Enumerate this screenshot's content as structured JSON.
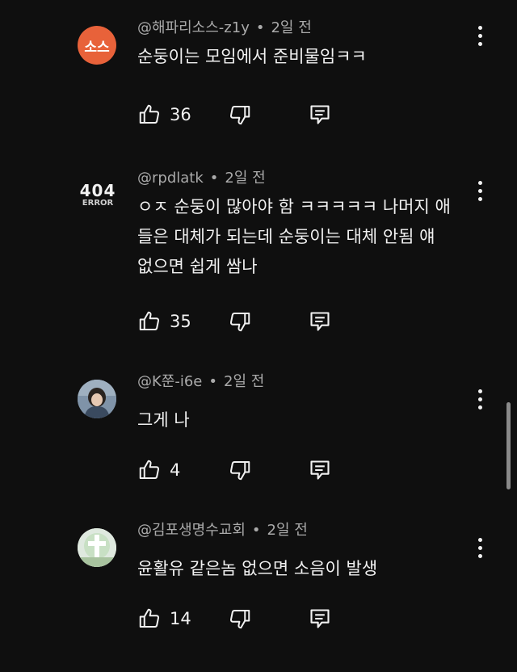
{
  "comments": [
    {
      "handle": "@해파리소스-z1y",
      "time": "2일 전",
      "avatar_text": "소스",
      "avatar_color": "#e8623a",
      "lines": [
        "순둥이는 모임에서 준비물임ㅋㅋ"
      ],
      "likes": "36"
    },
    {
      "handle": "@rpdlatk",
      "time": "2일 전",
      "avatar_text_top": "404",
      "avatar_text_bottom": "ERROR",
      "lines": [
        "ㅇㅈ 순둥이 많아야 함 ㅋㅋㅋㅋㅋ 나머지 애",
        "들은 대체가 되는데 순둥이는 대체 안됨 얘",
        "없으면 쉽게 쌈나"
      ],
      "likes": "35"
    },
    {
      "handle": "@K쭌-i6e",
      "time": "2일 전",
      "lines": [
        "그게 나"
      ],
      "likes": "4"
    },
    {
      "handle": "@김포생명수교회",
      "time": "2일 전",
      "lines": [
        "윤활유 같은놈 없으면 소음이 발생"
      ],
      "likes": "14"
    }
  ],
  "icons": {
    "like": "thumbs-up-icon",
    "dislike": "thumbs-down-icon",
    "reply": "reply-icon",
    "more": "more-vert-icon"
  }
}
